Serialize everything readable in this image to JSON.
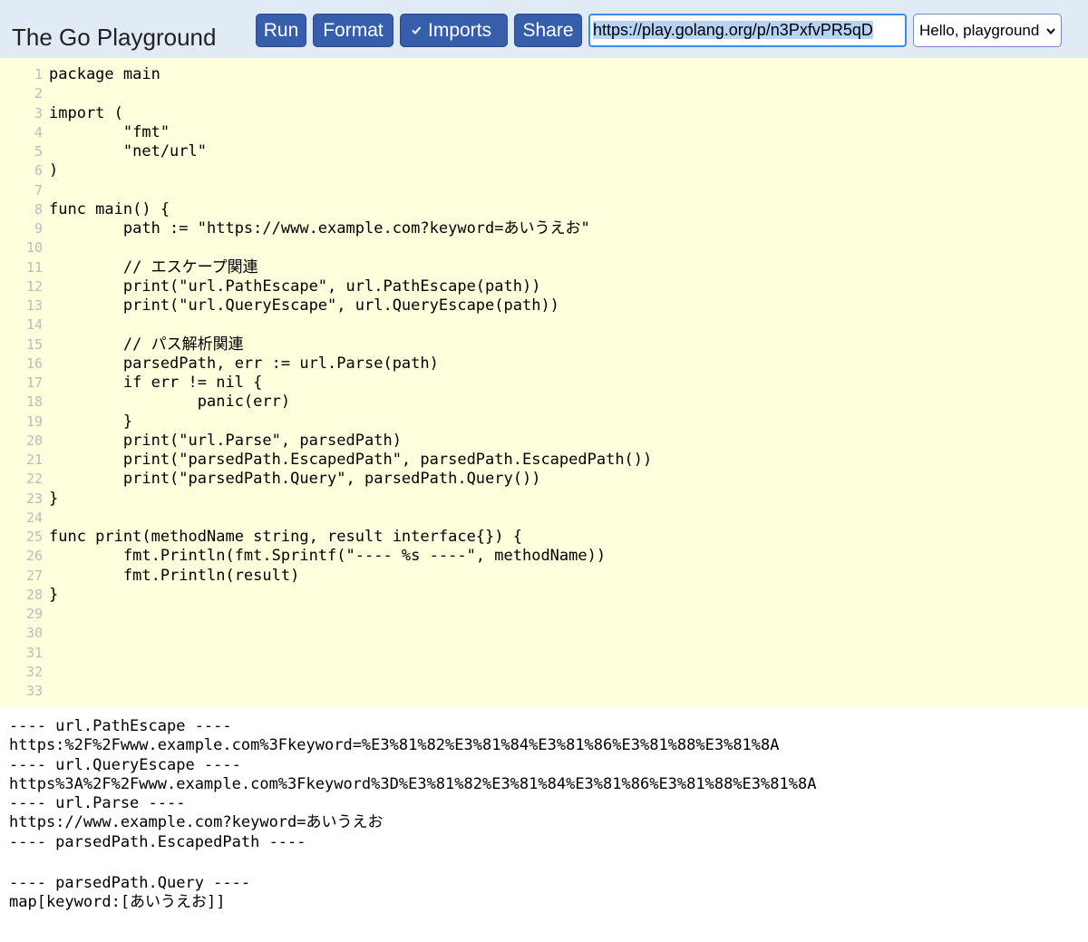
{
  "header": {
    "title": "The Go Playground",
    "run_label": "Run",
    "format_label": "Format",
    "imports_label": "Imports",
    "imports_checked": true,
    "share_label": "Share",
    "share_url": "https://play.golang.org/p/n3PxfvPR5qD",
    "example_select": "Hello, playground",
    "colors": {
      "banner": "#e0ebf5",
      "button": "#375eab",
      "editor": "#ffffdd"
    }
  },
  "editor": {
    "line_numbers": [
      "1",
      "2",
      "3",
      "4",
      "5",
      "6",
      "7",
      "8",
      "9",
      "10",
      "11",
      "12",
      "13",
      "14",
      "15",
      "16",
      "17",
      "18",
      "19",
      "20",
      "21",
      "22",
      "23",
      "24",
      "25",
      "26",
      "27",
      "28",
      "29",
      "30",
      "31",
      "32",
      "33"
    ],
    "lines": [
      "package main",
      "",
      "import (",
      "        \"fmt\"",
      "        \"net/url\"",
      ")",
      "",
      "func main() {",
      "        path := \"https://www.example.com?keyword=あいうえお\"",
      "",
      "        // エスケープ関連",
      "        print(\"url.PathEscape\", url.PathEscape(path))",
      "        print(\"url.QueryEscape\", url.QueryEscape(path))",
      "",
      "        // パス解析関連",
      "        parsedPath, err := url.Parse(path)",
      "        if err != nil {",
      "                panic(err)",
      "        }",
      "        print(\"url.Parse\", parsedPath)",
      "        print(\"parsedPath.EscapedPath\", parsedPath.EscapedPath())",
      "        print(\"parsedPath.Query\", parsedPath.Query())",
      "}",
      "",
      "func print(methodName string, result interface{}) {",
      "        fmt.Println(fmt.Sprintf(\"---- %s ----\", methodName))",
      "        fmt.Println(result)",
      "}",
      "",
      "",
      "",
      "",
      ""
    ]
  },
  "output": {
    "lines": [
      "---- url.PathEscape ----",
      "https:%2F%2Fwww.example.com%3Fkeyword=%E3%81%82%E3%81%84%E3%81%86%E3%81%88%E3%81%8A",
      "---- url.QueryEscape ----",
      "https%3A%2F%2Fwww.example.com%3Fkeyword%3D%E3%81%82%E3%81%84%E3%81%86%E3%81%88%E3%81%8A",
      "---- url.Parse ----",
      "https://www.example.com?keyword=あいうえお",
      "---- parsedPath.EscapedPath ----",
      "",
      "---- parsedPath.Query ----",
      "map[keyword:[あいうえお]]"
    ]
  }
}
